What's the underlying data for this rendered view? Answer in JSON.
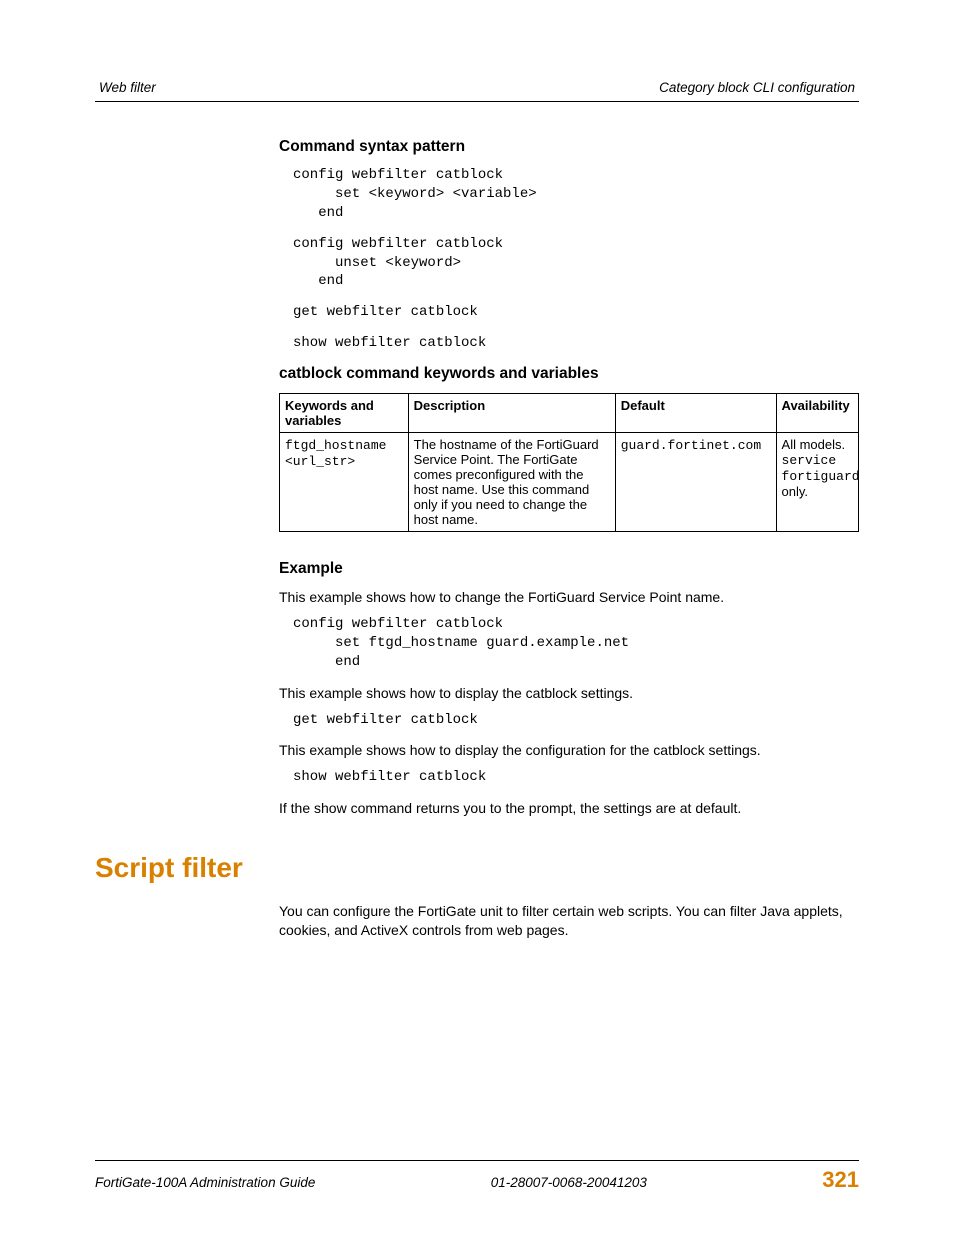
{
  "header": {
    "left": "Web filter",
    "right": "Category block CLI configuration"
  },
  "headings": {
    "syntax": "Command syntax pattern",
    "table_caption": "catblock command keywords and variables",
    "example": "Example",
    "script_filter": "Script filter"
  },
  "code": {
    "block1": "config webfilter catblock\n     set <keyword> <variable>\n   end",
    "block2": "config webfilter catblock\n     unset <keyword>\n   end",
    "block3": "get webfilter catblock",
    "block4": "show webfilter catblock",
    "ex1": "config webfilter catblock\n     set ftgd_hostname guard.example.net\n     end",
    "ex2": "get webfilter catblock",
    "ex3": "show webfilter catblock"
  },
  "table": {
    "h1": "Keywords and variables",
    "h2": "Description",
    "h3": "Default",
    "h4": "Availability",
    "r1c1a": "ftgd_hostname",
    "r1c1b": "<url_str>",
    "r1c2": "The hostname of the FortiGuard Service Point. The FortiGate comes preconfigured with the host name. Use this command only if you need to change the host name.",
    "r1c3": "guard.fortinet.com",
    "r1c4a": "All models.",
    "r1c4b": "service fortiguard",
    "r1c4c": " only."
  },
  "paragraphs": {
    "p1": "This example shows how to change the FortiGuard Service Point name.",
    "p2": "This example shows how to display the catblock settings.",
    "p3": "This example shows how to display the configuration for the catblock settings.",
    "p4": "If the show command returns you to the prompt, the settings are at default.",
    "script_body": "You can configure the FortiGate unit to filter certain web scripts. You can filter Java applets, cookies, and ActiveX controls from web pages."
  },
  "footer": {
    "left": "FortiGate-100A Administration Guide",
    "center": "01-28007-0068-20041203",
    "page": "321"
  }
}
